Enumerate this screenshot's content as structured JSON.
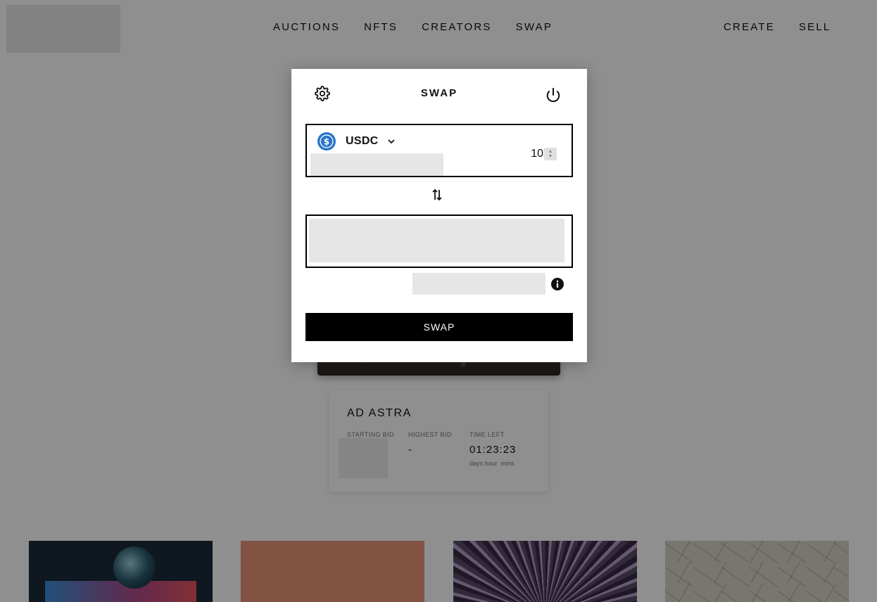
{
  "nav": {
    "center": [
      "AUCTIONS",
      "NFTS",
      "CREATORS",
      "SWAP"
    ],
    "right": [
      "CREATE",
      "SELL"
    ]
  },
  "auction_card": {
    "title": "AD ASTRA",
    "starting_bid_label": "STARTING BID",
    "highest_bid_label": "HIGHEST BID",
    "highest_bid_value": "-",
    "time_left_label": "TIME LEFT",
    "time_left_value": "01:23:23",
    "time_left_units": "days hour  mins"
  },
  "swap_modal": {
    "title": "SWAP",
    "settings_icon": "gear-icon",
    "power_icon": "power-icon",
    "from_token": {
      "symbol": "USDC",
      "icon": "usdc-icon",
      "amount": "10"
    },
    "switch_icon": "swap-arrows-icon",
    "info_icon": "info-icon",
    "submit_label": "SWAP"
  },
  "colors": {
    "overlay": "#707070",
    "usdc_blue": "#2775ca",
    "button_bg": "#000000"
  }
}
